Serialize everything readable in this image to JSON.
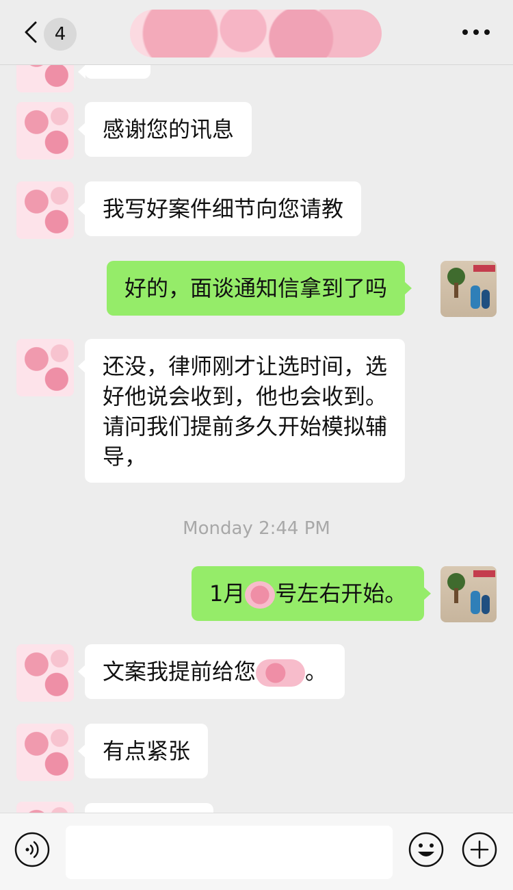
{
  "header": {
    "back_icon": "chevron-left-icon",
    "unread_count": "4",
    "more_icon": "ellipsis-icon"
  },
  "messages": [
    {
      "side": "in",
      "text": ""
    },
    {
      "side": "in",
      "text": "感谢您的讯息"
    },
    {
      "side": "in",
      "text": "我写好案件细节向您请教"
    },
    {
      "side": "out",
      "text": "好的，面谈通知信拿到了吗"
    },
    {
      "side": "in",
      "lines": [
        "还没，律师刚才让选时间，选",
        "好他说会收到，他也会收到。",
        "请问我们提前多久开始模拟辅",
        "导，"
      ]
    },
    {
      "side": "out",
      "text_before": "1月",
      "text_after": "号左右开始。"
    },
    {
      "side": "in",
      "text_before": "文案我提前给您",
      "text_after": "。"
    },
    {
      "side": "in",
      "text": "有点紧张"
    },
    {
      "side": "in",
      "text": ""
    }
  ],
  "timestamp": "Monday 2:44 PM",
  "input": {
    "value": "",
    "voice_icon": "voice-icon",
    "emoji_icon": "emoji-icon",
    "plus_icon": "plus-icon"
  },
  "colors": {
    "background": "#ededed",
    "outgoing_bubble": "#95ec69",
    "incoming_bubble": "#ffffff"
  }
}
